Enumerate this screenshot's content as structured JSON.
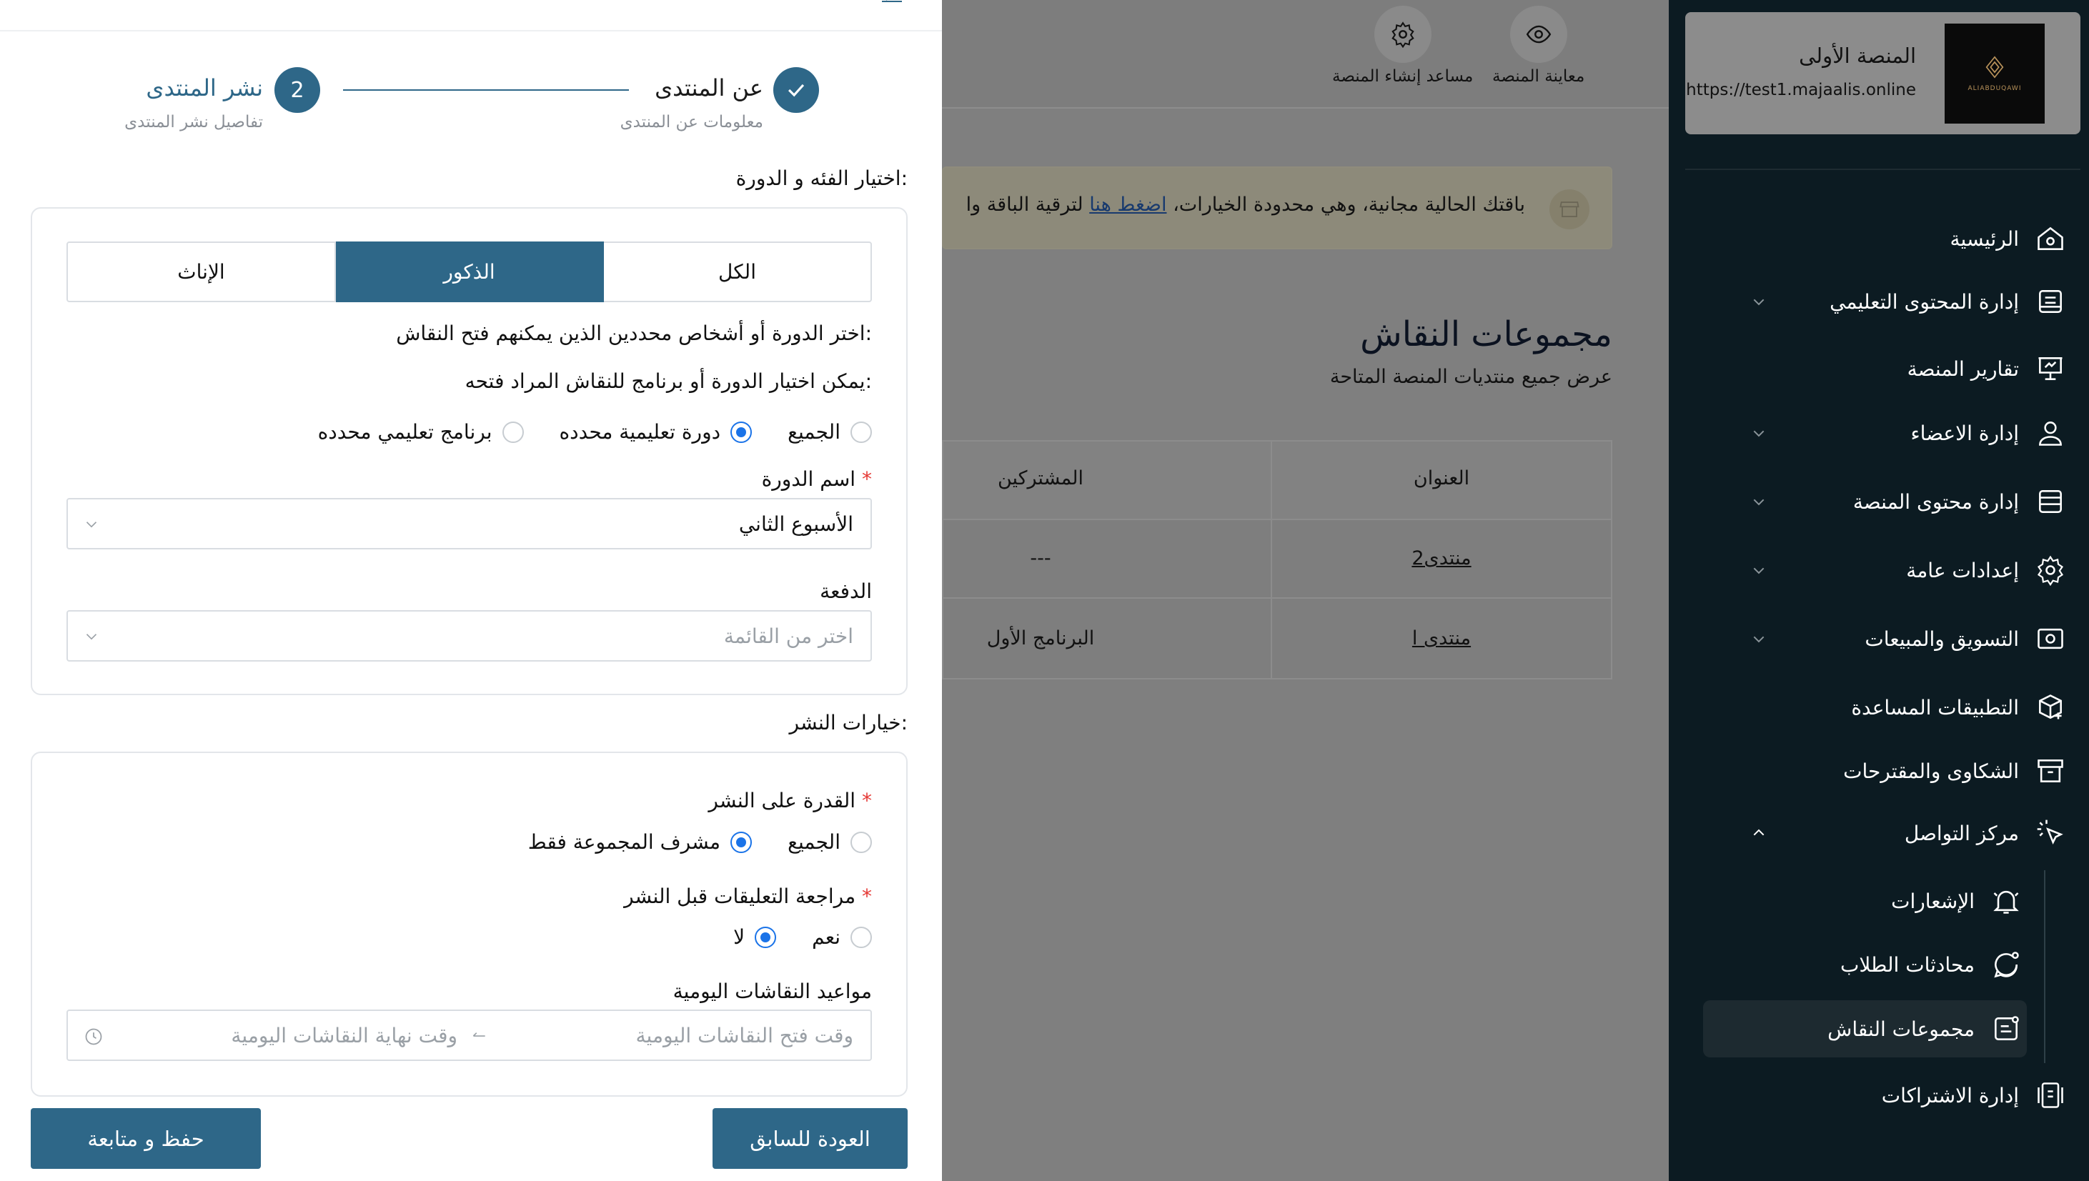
{
  "sidebar": {
    "brand": {
      "name": "المنصة الأولى",
      "url": "https://test1.majaalis.online",
      "logo_text": "ALIABDUQAWI"
    },
    "items": [
      {
        "label": "الرئيسية",
        "icon": "home-icon"
      },
      {
        "label": "إدارة المحتوى التعليمي",
        "icon": "book-icon"
      },
      {
        "label": "تقارير المنصة",
        "icon": "presentation-chart-icon"
      },
      {
        "label": "إدارة الاعضاء",
        "icon": "user-icon"
      },
      {
        "label": "إدارة محتوى المنصة",
        "icon": "list-icon"
      },
      {
        "label": "إعدادات عامة",
        "icon": "gear-icon"
      },
      {
        "label": "التسويق والمبيعات",
        "icon": "ticket-icon"
      },
      {
        "label": "التطبيقات المساعدة",
        "icon": "box-plus-icon"
      },
      {
        "label": "الشكاوى والمقترحات",
        "icon": "archive-icon"
      },
      {
        "label": "مركز التواصل",
        "icon": "cursor-click-icon"
      },
      {
        "label": "الإشعارات",
        "icon": "bell-icon"
      },
      {
        "label": "محادثات الطلاب",
        "icon": "chat-icon"
      },
      {
        "label": "مجموعات النقاش",
        "icon": "group-chat-icon"
      },
      {
        "label": "إدارة الاشتراكات",
        "icon": "subscription-icon"
      }
    ]
  },
  "topbar": {
    "preview_label": "معاينة المنصة",
    "assistant_label": "مساعد إنشاء المنصة"
  },
  "banner": {
    "text_before": "باقتك الحالية مجانية، وهي محدودة الخيارات،",
    "link": "اضغط هنا",
    "text_after": "لترقية الباقة وا"
  },
  "page": {
    "title": "مجموعات النقاش",
    "subtitle": "عرض جميع منتديات المنصة المتاحة"
  },
  "table": {
    "headers": [
      "العنوان",
      "المشتركين"
    ],
    "rows": [
      [
        "منتدى2",
        "---"
      ],
      [
        "منتدى ا",
        "البرنامج الأول"
      ]
    ]
  },
  "drawer": {
    "steps": [
      {
        "title": "عن المنتدى",
        "subtitle": "معلومات عن المنتدى"
      },
      {
        "number": "2",
        "title": "نشر المنتدى",
        "subtitle": "تفاصيل نشر المنتدى"
      }
    ],
    "category_label": "اختيار الفئه و الدورة:",
    "segments": [
      "الكل",
      "الذكور",
      "الإناث"
    ],
    "select_people_text": "اختر الدورة أو أشخاص محددين الذين يمكنهم فتح النقاش:",
    "select_course_hint": "يمكن اختيار الدورة أو برنامج للنقاش المراد فتحه:",
    "scope_options": [
      "الجميع",
      "دورة تعليمية محدده",
      "برنامج تعليمي محدده"
    ],
    "course_name_label": "اسم الدورة",
    "course_name_value": "الأسبوع الثاني",
    "batch_label": "الدفعة",
    "batch_placeholder": "اختر من القائمة",
    "publish_options_label": "خيارات النشر:",
    "post_ability_label": "القدرة على النشر",
    "post_ability_options": [
      "الجميع",
      "مشرف المجموعة فقط"
    ],
    "review_label": "مراجعة التعليقات قبل النشر",
    "review_options": [
      "نعم",
      "لا"
    ],
    "schedule_label": "مواعيد النقاشات اليومية",
    "open_time_placeholder": "وقت فتح النقاشات اليومية",
    "close_time_placeholder": "وقت نهاية النقاشات اليومية",
    "back_button": "العودة للسابق",
    "save_button": "حفظ و متابعة"
  },
  "colors": {
    "primary": "#2e6788",
    "sidebar_bg": "#0c1b22",
    "radio_selected": "#1a73e8"
  }
}
